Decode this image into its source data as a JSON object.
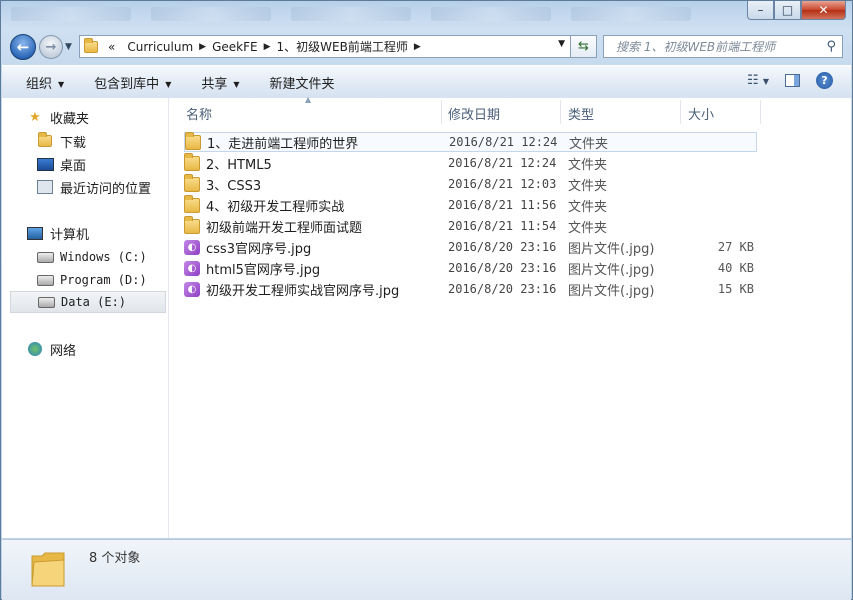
{
  "window": {
    "caption": {
      "minimize": "–",
      "maximize": "□",
      "close": "✕"
    }
  },
  "nav": {
    "back_glyph": "←",
    "forward_glyph": "→",
    "breadcrumbs": [
      "Curriculum",
      "GeekFE",
      "1、初级WEB前端工程师"
    ],
    "overflow": "«",
    "search_placeholder": "搜索 1、初级WEB前端工程师"
  },
  "toolbar": {
    "organize": "组织",
    "include_in_library": "包含到库中",
    "share": "共享",
    "new_folder": "新建文件夹",
    "help": "?"
  },
  "sidebar": {
    "favorites_label": "收藏夹",
    "favorites": [
      "下载",
      "桌面",
      "最近访问的位置"
    ],
    "computer_label": "计算机",
    "drives": [
      "Windows (C:)",
      "Program (D:)",
      "Data (E:)"
    ],
    "network_label": "网络"
  },
  "columns": {
    "name": "名称",
    "modified": "修改日期",
    "type": "类型",
    "size": "大小"
  },
  "files": [
    {
      "name": "1、走进前端工程师的世界",
      "modified": "2016/8/21 12:24",
      "type": "文件夹",
      "size": "",
      "kind": "folder"
    },
    {
      "name": "2、HTML5",
      "modified": "2016/8/21 12:24",
      "type": "文件夹",
      "size": "",
      "kind": "folder"
    },
    {
      "name": "3、CSS3",
      "modified": "2016/8/21 12:03",
      "type": "文件夹",
      "size": "",
      "kind": "folder"
    },
    {
      "name": "4、初级开发工程师实战",
      "modified": "2016/8/21 11:56",
      "type": "文件夹",
      "size": "",
      "kind": "folder"
    },
    {
      "name": "初级前端开发工程师面试题",
      "modified": "2016/8/21 11:54",
      "type": "文件夹",
      "size": "",
      "kind": "folder"
    },
    {
      "name": "css3官网序号.jpg",
      "modified": "2016/8/20 23:16",
      "type": "图片文件(.jpg)",
      "size": "27 KB",
      "kind": "image"
    },
    {
      "name": "html5官网序号.jpg",
      "modified": "2016/8/20 23:16",
      "type": "图片文件(.jpg)",
      "size": "40 KB",
      "kind": "image"
    },
    {
      "name": "初级开发工程师实战官网序号.jpg",
      "modified": "2016/8/20 23:16",
      "type": "图片文件(.jpg)",
      "size": "15 KB",
      "kind": "image"
    }
  ],
  "status": {
    "count": "8 个对象"
  },
  "colors": {
    "accent": "#2c6ab9",
    "folder": "#e8b847",
    "image_icon": "#8e3fc4"
  }
}
